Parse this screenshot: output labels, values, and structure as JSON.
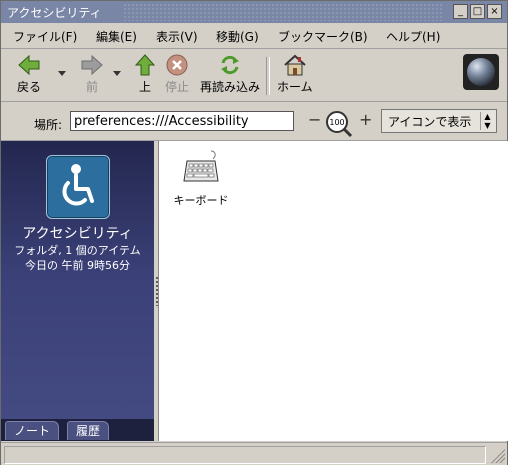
{
  "window": {
    "title": "アクセシビリティ",
    "buttons": {
      "minimize": "_",
      "maximize": "□",
      "close": "×"
    }
  },
  "menubar": {
    "items": [
      {
        "label": "ファイル(F)"
      },
      {
        "label": "編集(E)"
      },
      {
        "label": "表示(V)"
      },
      {
        "label": "移動(G)"
      },
      {
        "label": "ブックマーク(B)"
      },
      {
        "label": "ヘルプ(H)"
      }
    ]
  },
  "toolbar": {
    "back": {
      "label": "戻る",
      "icon": "back-arrow-icon"
    },
    "forward": {
      "label": "前",
      "icon": "forward-arrow-icon",
      "enabled": false
    },
    "up": {
      "label": "上",
      "icon": "up-arrow-icon"
    },
    "stop": {
      "label": "停止",
      "icon": "stop-icon",
      "enabled": false
    },
    "reload": {
      "label": "再読み込み",
      "icon": "reload-icon"
    },
    "home": {
      "label": "ホーム",
      "icon": "home-icon"
    }
  },
  "location": {
    "label": "場所:",
    "value": "preferences:///Accessibility",
    "zoom_level": "100",
    "view_mode": "アイコンで表示"
  },
  "sidebar": {
    "folder_title": "アクセシビリティ",
    "info_line1": "フォルダ, 1 個のアイテム",
    "info_line2": "今日の 午前 9時56分",
    "tabs": [
      {
        "label": "ノート"
      },
      {
        "label": "履歴"
      }
    ]
  },
  "content": {
    "items": [
      {
        "label": "キーボード",
        "icon": "keyboard-icon"
      }
    ]
  },
  "colors": {
    "titlebar": "#7a86a5",
    "sidebar_top": "#23274f",
    "sidebar_bottom": "#454b83",
    "chrome": "#d4d0c8",
    "accent_icon": "#2c6f9e"
  }
}
